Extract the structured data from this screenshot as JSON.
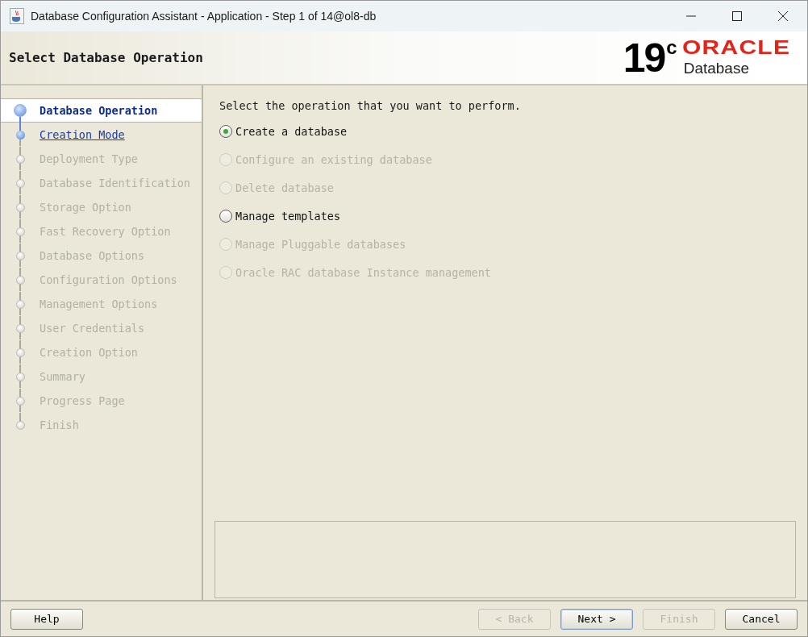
{
  "window": {
    "title": "Database Configuration Assistant - Application - Step 1 of 14@ol8-db"
  },
  "header": {
    "title": "Select Database Operation",
    "logo": {
      "version": "19",
      "version_suffix": "c",
      "brand": "ORACLE",
      "product": "Database"
    }
  },
  "steps": [
    {
      "label": "Database Operation",
      "selected": true,
      "enabled": true
    },
    {
      "label": "Creation Mode",
      "selected": false,
      "enabled": true
    },
    {
      "label": "Deployment Type",
      "selected": false,
      "enabled": false
    },
    {
      "label": "Database Identification",
      "selected": false,
      "enabled": false
    },
    {
      "label": "Storage Option",
      "selected": false,
      "enabled": false
    },
    {
      "label": "Fast Recovery Option",
      "selected": false,
      "enabled": false
    },
    {
      "label": "Database Options",
      "selected": false,
      "enabled": false
    },
    {
      "label": "Configuration Options",
      "selected": false,
      "enabled": false
    },
    {
      "label": "Management Options",
      "selected": false,
      "enabled": false
    },
    {
      "label": "User Credentials",
      "selected": false,
      "enabled": false
    },
    {
      "label": "Creation Option",
      "selected": false,
      "enabled": false
    },
    {
      "label": "Summary",
      "selected": false,
      "enabled": false
    },
    {
      "label": "Progress Page",
      "selected": false,
      "enabled": false
    },
    {
      "label": "Finish",
      "selected": false,
      "enabled": false
    }
  ],
  "prompt": "Select the operation that you want to perform.",
  "operations": [
    {
      "label": "Create a database",
      "selected": true,
      "disabled": false
    },
    {
      "label": "Configure an existing database",
      "selected": false,
      "disabled": true
    },
    {
      "label": "Delete database",
      "selected": false,
      "disabled": true
    },
    {
      "label": "Manage templates",
      "selected": false,
      "disabled": false
    },
    {
      "label": "Manage Pluggable databases",
      "selected": false,
      "disabled": true
    },
    {
      "label": "Oracle RAC database Instance management",
      "selected": false,
      "disabled": true
    }
  ],
  "buttons_left": [
    {
      "label": "Help",
      "disabled": false,
      "default": false
    }
  ],
  "buttons_right": [
    {
      "label": "< Back",
      "disabled": true,
      "default": false
    },
    {
      "label": "Next >",
      "disabled": false,
      "default": true
    },
    {
      "label": "Finish",
      "disabled": true,
      "default": false
    },
    {
      "label": "Cancel",
      "disabled": false,
      "default": false
    }
  ]
}
